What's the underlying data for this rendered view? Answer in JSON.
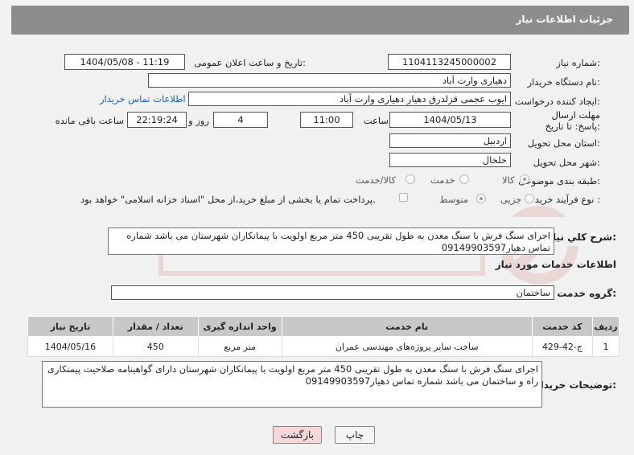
{
  "header": {
    "title": "جزئیات اطلاعات نیاز"
  },
  "form": {
    "need_number_label": "شماره نیاز:",
    "need_number": "1104113245000002",
    "announce_label": "تاریخ و ساعت اعلان عمومی:",
    "announce_value": "1404/05/08 - 11:19",
    "buyer_org_label": "نام دستگاه خریدار:",
    "buyer_org": "دهیاری وارت آباد",
    "creator_label": "ایجاد کننده درخواست:",
    "creator": "ایوب عجمی قزلدرق دهیار دهیاری وارت آباد",
    "contact_link": "اطلاعات تماس خریدار",
    "deadline_label": "مهلت ارسال پاسخ: تا تاریخ:",
    "deadline_date": "1404/05/13",
    "time_label": "ساعت",
    "deadline_time": "11:00",
    "days_value": "4",
    "days_label": "روز و",
    "remaining_time": "22:19:24",
    "remaining_label": "ساعت باقی مانده",
    "province_label": "استان محل تحویل:",
    "province": "اردبیل",
    "city_label": "شهر محل تحویل:",
    "city": "خلخال",
    "category_label": "طبقه بندی موضوعی:",
    "category_options": [
      "کالا",
      "خدمت",
      "کالا/خدمت"
    ],
    "process_label": "نوع فرآیند خرید :",
    "process_options": [
      "جزیی",
      "متوسط"
    ],
    "payment_note": "پرداخت تمام یا بخشی از مبلغ خرید،از محل \"اسناد خزانه اسلامی\" خواهد بود."
  },
  "summary": {
    "label": "شرح کلي نیاز:",
    "text": "اجرای سنگ فرش با سنگ معدن به طول تقریبی 450 متر مربع  اولویت با پیمانکاران شهرستان  می باشد شماره تماس دهیار09149903597"
  },
  "services": {
    "title": "اطلاعات خدمات مورد نیاز",
    "group_label": "گروه خدمت:",
    "group_value": "ساختمان",
    "columns": [
      "ردیف",
      "کد خدمت",
      "نام خدمت",
      "واحد اندازه گیری",
      "تعداد / مقدار",
      "تاریخ نیاز"
    ],
    "rows": [
      [
        "1",
        "ج-42-429",
        "ساخت سایر پروژه‌های مهندسی عمران",
        "متر مربع",
        "450",
        "1404/05/16"
      ]
    ]
  },
  "buyer_notes": {
    "label": "توضیحات خریدار:",
    "text": "اجرای سنگ فرش با سنگ معدن به طول تقریبی 450 متر مربع  اولویت با پیمانکاران شهرستان  دارای گواهینامه صلاحیت پیمنکاری راه و ساختمان می باشد شماره تماس دهیار09149903597"
  },
  "buttons": {
    "print": "چاپ",
    "back": "بازگشت"
  },
  "colors": {
    "header_bg": "#8d8d8d",
    "back_button_bg": "#f7d7d7",
    "link": "#1a5fb4"
  }
}
